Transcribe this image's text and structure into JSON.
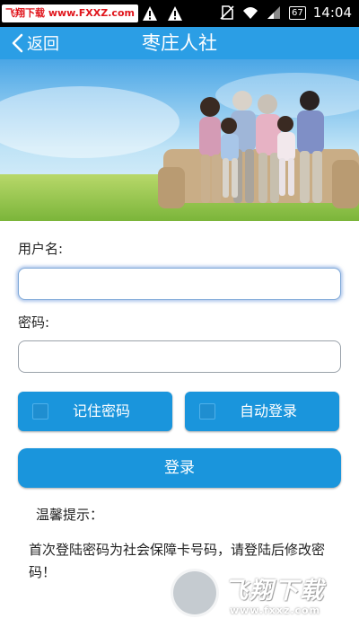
{
  "status_bar": {
    "watermark": "飞翔下载 www.FXXZ.com",
    "battery": "67",
    "time": "14:04",
    "icons": [
      "warning-icon",
      "warning-icon",
      "sim-off-icon",
      "wifi-icon",
      "signal-icon",
      "battery-icon"
    ]
  },
  "header": {
    "back_label": "返回",
    "title": "枣庄人社",
    "color": "#2b9ee5"
  },
  "form": {
    "username_label": "用户名:",
    "username_value": "",
    "password_label": "密码:",
    "password_value": "",
    "remember_label": "记住密码",
    "remember_checked": false,
    "auto_login_label": "自动登录",
    "auto_login_checked": false,
    "login_label": "登录",
    "accent": "#1a95dc"
  },
  "tips": {
    "title": "温馨提示：",
    "body": "首次登陆密码为社会保障卡号码，请登陆后修改密码！"
  },
  "watermark": {
    "brand": "飞翔下载",
    "url": "www.fxxz.com"
  }
}
